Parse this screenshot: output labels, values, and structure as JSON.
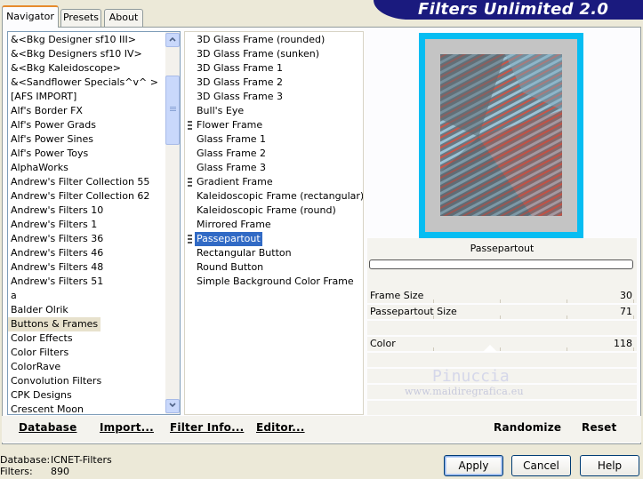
{
  "header": {
    "title": "Filters Unlimited 2.0"
  },
  "tabs": [
    {
      "label": "Navigator",
      "active": true
    },
    {
      "label": "Presets",
      "active": false
    },
    {
      "label": "About",
      "active": false
    }
  ],
  "categories": {
    "items": [
      "&<Bkg Designer sf10 III>",
      "&<Bkg Designers sf10 IV>",
      "&<Bkg Kaleidoscope>",
      "&<Sandflower Specials^v^ >",
      "[AFS IMPORT]",
      "Alf's Border FX",
      "Alf's Power Grads",
      "Alf's Power Sines",
      "Alf's Power Toys",
      "AlphaWorks",
      "Andrew's Filter Collection 55",
      "Andrew's Filter Collection 62",
      "Andrew's Filters 10",
      "Andrew's Filters 1",
      "Andrew's Filters 36",
      "Andrew's Filters 46",
      "Andrew's Filters 48",
      "Andrew's Filters 51",
      "a",
      "Balder Olrik",
      "Buttons & Frames",
      "Color Effects",
      "Color Filters",
      "ColorRave",
      "Convolution Filters",
      "CPK Designs",
      "Crescent Moon"
    ],
    "selected": "Buttons & Frames"
  },
  "filters": {
    "items": [
      {
        "label": "3D Glass Frame (rounded)",
        "grip": false
      },
      {
        "label": "3D Glass Frame (sunken)",
        "grip": false
      },
      {
        "label": "3D Glass Frame 1",
        "grip": false
      },
      {
        "label": "3D Glass Frame 2",
        "grip": false
      },
      {
        "label": "3D Glass Frame 3",
        "grip": false
      },
      {
        "label": "Bull's Eye",
        "grip": false
      },
      {
        "label": "Flower Frame",
        "grip": true
      },
      {
        "label": "Glass Frame 1",
        "grip": false
      },
      {
        "label": "Glass Frame 2",
        "grip": false
      },
      {
        "label": "Glass Frame 3",
        "grip": false
      },
      {
        "label": "Gradient Frame",
        "grip": true
      },
      {
        "label": "Kaleidoscopic Frame (rectangular)",
        "grip": false
      },
      {
        "label": "Kaleidoscopic Frame (round)",
        "grip": false
      },
      {
        "label": "Mirrored Frame",
        "grip": false
      },
      {
        "label": "Passepartout",
        "grip": true
      },
      {
        "label": "Rectangular Button",
        "grip": false
      },
      {
        "label": "Round Button",
        "grip": false
      },
      {
        "label": "Simple Background Color Frame",
        "grip": false
      }
    ],
    "selected": "Passepartout"
  },
  "commands": {
    "database": "Database",
    "import": "Import...",
    "filter_info": "Filter Info...",
    "editor": "Editor...",
    "randomize": "Randomize",
    "reset": "Reset"
  },
  "preview": {
    "filter_name": "Passepartout"
  },
  "params": [
    {
      "label": "Frame Size",
      "value": "30"
    },
    {
      "label": "Passepartout Size",
      "value": "71"
    },
    {
      "label": "Color",
      "value": "118"
    }
  ],
  "watermark": {
    "name": "Pinuccia",
    "site": "www.maidiregrafica.eu"
  },
  "status": {
    "database_label": "Database:",
    "database_value": "ICNET-Filters",
    "filters_label": "Filters:",
    "filters_value": "890"
  },
  "buttons": {
    "apply": "Apply",
    "cancel": "Cancel",
    "help": "Help"
  },
  "colors": {
    "preview_border": "#06bdf2",
    "selection": "#316ac5",
    "banner": "#1a1a7e",
    "tab_accent": "#e68b2c"
  }
}
